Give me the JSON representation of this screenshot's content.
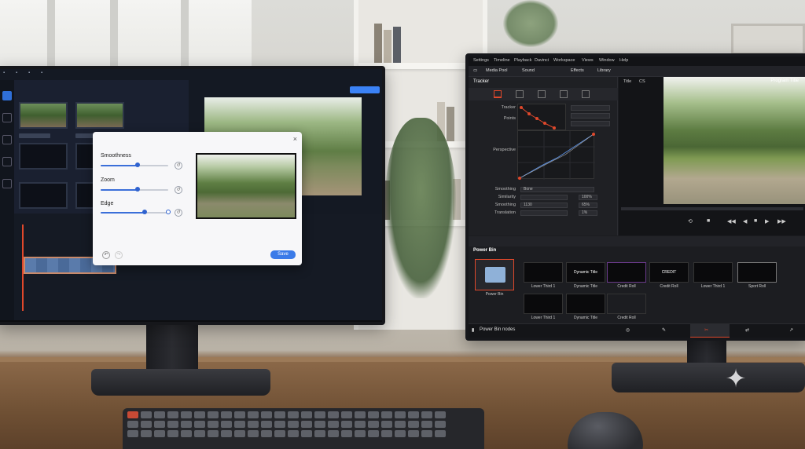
{
  "left_app": {
    "dialog": {
      "close_icon": "×",
      "sliders": [
        {
          "label": "Smoothness",
          "value": 0.55
        },
        {
          "label": "Zoom",
          "value": 0.55
        },
        {
          "label": "Edge",
          "value": 0.65
        }
      ],
      "save_label": "Save"
    }
  },
  "right_app": {
    "menu": [
      "Settings",
      "Timeline",
      "Playback",
      "Davinci",
      "Workspace",
      "Views",
      "Window",
      "Help"
    ],
    "toolbar": {
      "media_pool": "Media Pool",
      "sound": "Sound",
      "effects": "Effects",
      "library": "Library"
    },
    "inspector": {
      "tab": "Tracker",
      "labels": {
        "tracker": "Tracker",
        "points": "Points",
        "perspective": "Perspective",
        "smoothing": "Smoothing",
        "similarity": "Similarity",
        "smoothing2": "Smoothing",
        "translation": "Translation"
      },
      "values": {
        "smoothing": "Bone",
        "similarity": "100%",
        "smoothing2_a": "1130",
        "smoothing2_b": "65%",
        "translation": "1%"
      }
    },
    "viewer": {
      "title": "Program Title",
      "tab_a": "Title",
      "tab_b": "CS"
    },
    "bins": {
      "title": "Power Bin",
      "folder_label": "Power Bin",
      "items": [
        {
          "label": "Lower Third 1",
          "text": ""
        },
        {
          "label": "Dynamic Title",
          "text": "Dynamic Title"
        },
        {
          "label": "Credit Roll",
          "text": ""
        },
        {
          "label": "Credit Roll",
          "text": "CREDIT"
        },
        {
          "label": "Lower Third 1",
          "text": ""
        },
        {
          "label": "Sport Roll",
          "text": ""
        }
      ],
      "items_row2": [
        {
          "label": "Lower Third 1"
        },
        {
          "label": "Dynamic Title"
        },
        {
          "label": "Credit Roll"
        }
      ]
    },
    "bottom_bar": {
      "label": "Power Bin nodes"
    }
  },
  "colors": {
    "accent_red": "#e0482b",
    "accent_blue": "#3b7be8"
  }
}
